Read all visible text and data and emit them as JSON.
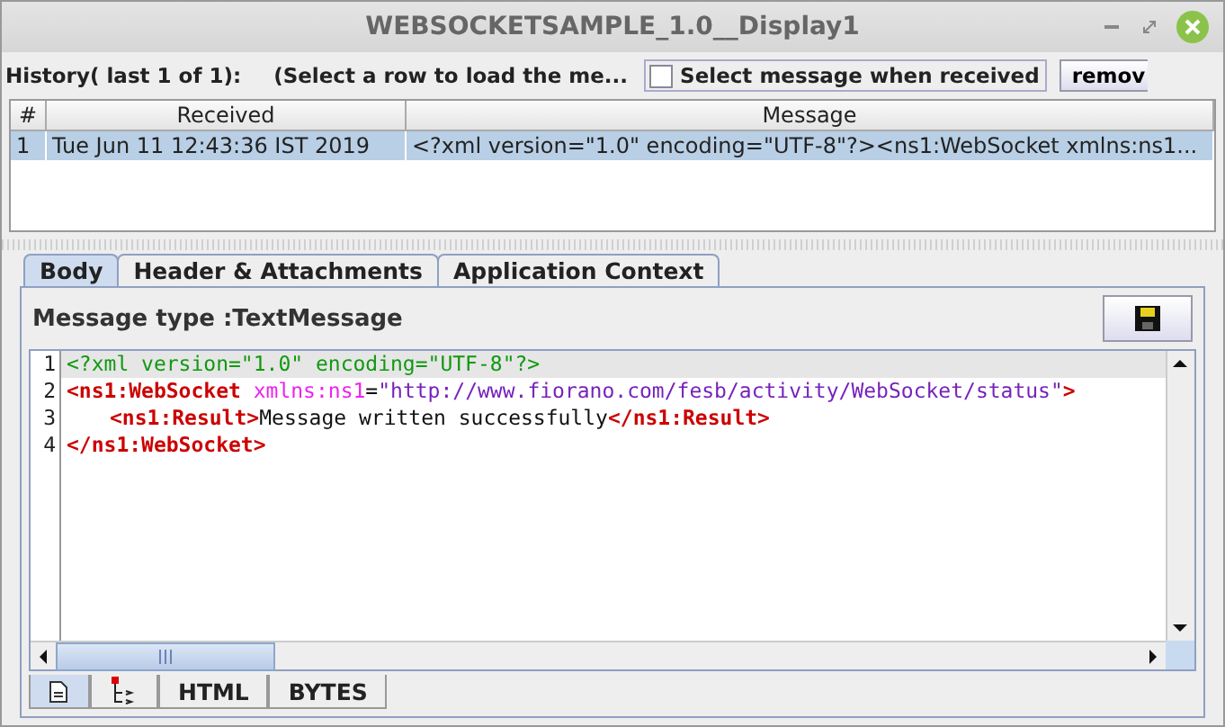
{
  "window": {
    "title": "WEBSOCKETSAMPLE_1.0__Display1"
  },
  "history": {
    "label": "History( last 1 of 1):",
    "hint": "(Select a row to load the me...",
    "auto_select": {
      "label": "Select message when received",
      "checked": false
    },
    "remove_button": "remov"
  },
  "table": {
    "columns": [
      "#",
      "Received",
      "Message"
    ],
    "rows": [
      {
        "cells": [
          "1",
          "Tue Jun 11 12:43:36 IST 2019",
          "<?xml version=\"1.0\" encoding=\"UTF-8\"?><ns1:WebSocket xmlns:ns1..."
        ],
        "selected": true
      }
    ]
  },
  "tabs": [
    {
      "label": "Body",
      "selected": true
    },
    {
      "label": "Header & Attachments",
      "selected": false
    },
    {
      "label": "Application Context",
      "selected": false
    }
  ],
  "message_type": "Message type :TextMessage",
  "editor": {
    "lines": [
      {
        "number": "1",
        "highlighted": true,
        "indented": false,
        "tokens": [
          {
            "kind": "decl",
            "text": "<?xml version=\"1.0\" encoding=\"UTF-8\"?>"
          }
        ]
      },
      {
        "number": "2",
        "highlighted": false,
        "indented": false,
        "tokens": [
          {
            "kind": "tag",
            "text": "<ns1:WebSocket "
          },
          {
            "kind": "attr",
            "text": "xmlns:ns1"
          },
          {
            "kind": "text",
            "text": "="
          },
          {
            "kind": "value",
            "text": "\"http://www.fiorano.com/fesb/activity/WebSocket/status\""
          },
          {
            "kind": "tag",
            "text": ">"
          }
        ]
      },
      {
        "number": "3",
        "highlighted": false,
        "indented": true,
        "tokens": [
          {
            "kind": "tag",
            "text": "<ns1:Result>"
          },
          {
            "kind": "text",
            "text": "Message written successfully"
          },
          {
            "kind": "tag",
            "text": "</ns1:Result>"
          }
        ]
      },
      {
        "number": "4",
        "highlighted": false,
        "indented": false,
        "tokens": [
          {
            "kind": "tag",
            "text": "</ns1:WebSocket>"
          }
        ]
      }
    ]
  },
  "view_tabs": [
    {
      "kind": "document",
      "selected": true
    },
    {
      "kind": "tree",
      "selected": false
    },
    {
      "kind": "text",
      "label": "HTML",
      "selected": false
    },
    {
      "kind": "text",
      "label": "BYTES",
      "selected": false
    }
  ]
}
